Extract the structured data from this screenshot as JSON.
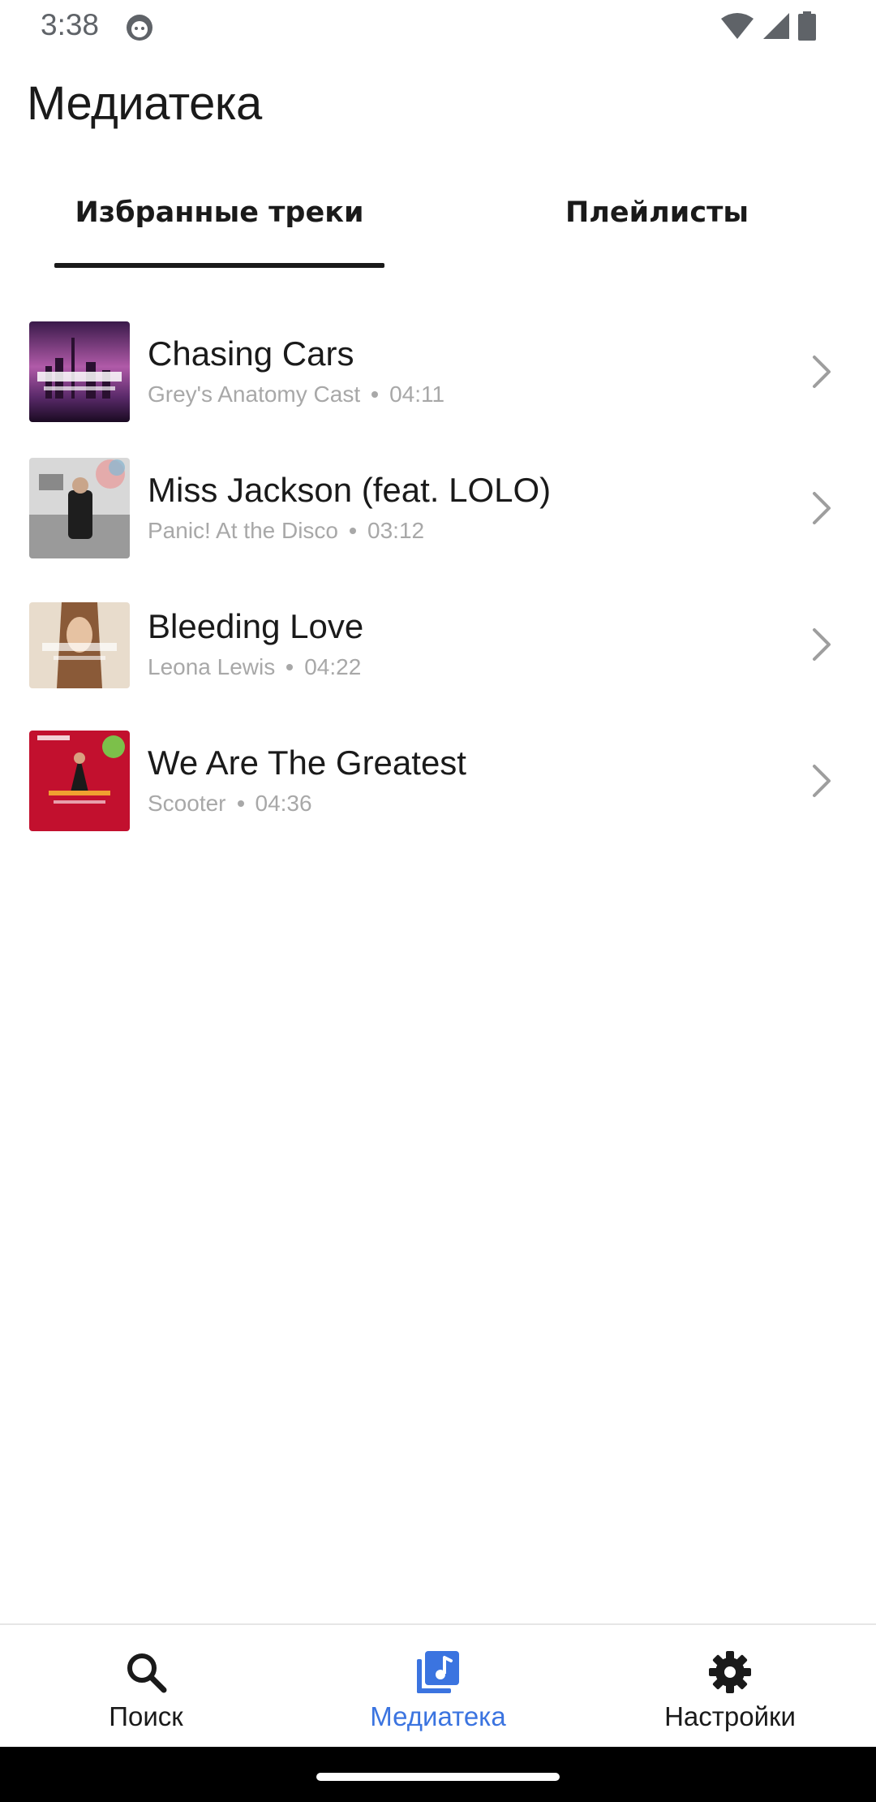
{
  "status_bar": {
    "time": "3:38",
    "icons": [
      "notification-icon",
      "wifi-icon",
      "cellular-icon",
      "battery-icon"
    ]
  },
  "header": {
    "title": "Медиатека"
  },
  "tabs": [
    {
      "label": "Избранные треки",
      "active": true
    },
    {
      "label": "Плейлисты",
      "active": false
    }
  ],
  "tracks": [
    {
      "title": "Chasing Cars",
      "artist": "Grey's Anatomy Cast",
      "duration": "04:11"
    },
    {
      "title": "Miss Jackson (feat. LOLO)",
      "artist": "Panic! At the Disco",
      "duration": "03:12"
    },
    {
      "title": "Bleeding Love",
      "artist": "Leona Lewis",
      "duration": "04:22"
    },
    {
      "title": "We Are The Greatest",
      "artist": "Scooter",
      "duration": "04:36"
    }
  ],
  "bottom_nav": [
    {
      "label": "Поиск",
      "icon": "search-icon",
      "active": false
    },
    {
      "label": "Медиатека",
      "icon": "library-icon",
      "active": true
    },
    {
      "label": "Настройки",
      "icon": "settings-icon",
      "active": false
    }
  ],
  "colors": {
    "accent": "#3b74e0",
    "text_primary": "#1a1a1a",
    "text_secondary": "#a8a8a8",
    "chevron": "#9e9e9e"
  }
}
